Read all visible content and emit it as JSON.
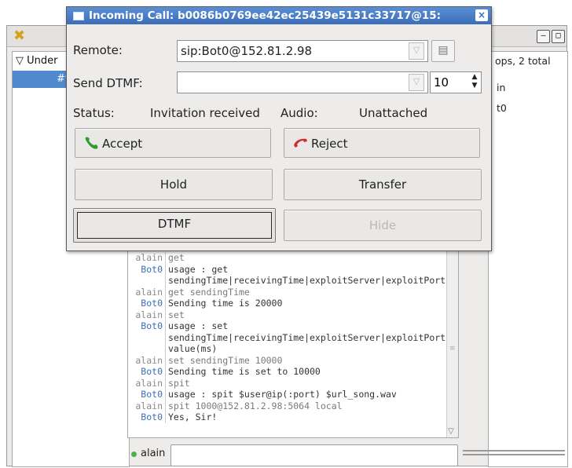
{
  "background": {
    "window_controls": [
      "–",
      "□"
    ],
    "tree": {
      "root_label": "Under",
      "selected_label": "#v"
    },
    "right_panel": {
      "header": "ops, 2 total",
      "items": [
        "in",
        "t0"
      ]
    },
    "chat": {
      "lines": [
        {
          "nick": "alain",
          "text": "get",
          "role": "alain"
        },
        {
          "nick": "Bot0",
          "text": "usage : get sendingTime|receivingTime|exploitServer|exploitPort",
          "role": "bot"
        },
        {
          "nick": "alain",
          "text": "get sendingTime",
          "role": "alain"
        },
        {
          "nick": "Bot0",
          "text": "Sending time is 20000",
          "role": "bot"
        },
        {
          "nick": "alain",
          "text": "set",
          "role": "alain"
        },
        {
          "nick": "Bot0",
          "text": "usage : set sendingTime|receivingTime|exploitServer|exploitPort value(ms)",
          "role": "bot"
        },
        {
          "nick": "alain",
          "text": "set sendingTime 10000",
          "role": "alain"
        },
        {
          "nick": "Bot0",
          "text": "Sending time is set to 10000",
          "role": "bot"
        },
        {
          "nick": "alain",
          "text": "spit",
          "role": "alain"
        },
        {
          "nick": "Bot0",
          "text": "usage : spit $user@ip(:port) $url_song.wav",
          "role": "bot"
        },
        {
          "nick": "alain",
          "text": "spit 1000@152.81.2.98:5064 local",
          "role": "alain"
        },
        {
          "nick": "Bot0",
          "text": "Yes, Sir!",
          "role": "bot"
        }
      ]
    },
    "input": {
      "nick": "alain",
      "value": ""
    }
  },
  "dialog": {
    "title": "Incoming Call: b0086b0769ee42ec25439e5131c33717@15:",
    "close": "×",
    "remote_label": "Remote:",
    "remote_value": "sip:Bot0@152.81.2.98",
    "dtmf_label": "Send DTMF:",
    "dtmf_value": "",
    "dtmf_duration": "10",
    "status_label": "Status:",
    "status_value": "Invitation received",
    "audio_label": "Audio:",
    "audio_value": "Unattached",
    "buttons": {
      "accept": "Accept",
      "reject": "Reject",
      "hold": "Hold",
      "transfer": "Transfer",
      "dtmf": "DTMF",
      "hide": "Hide"
    }
  }
}
